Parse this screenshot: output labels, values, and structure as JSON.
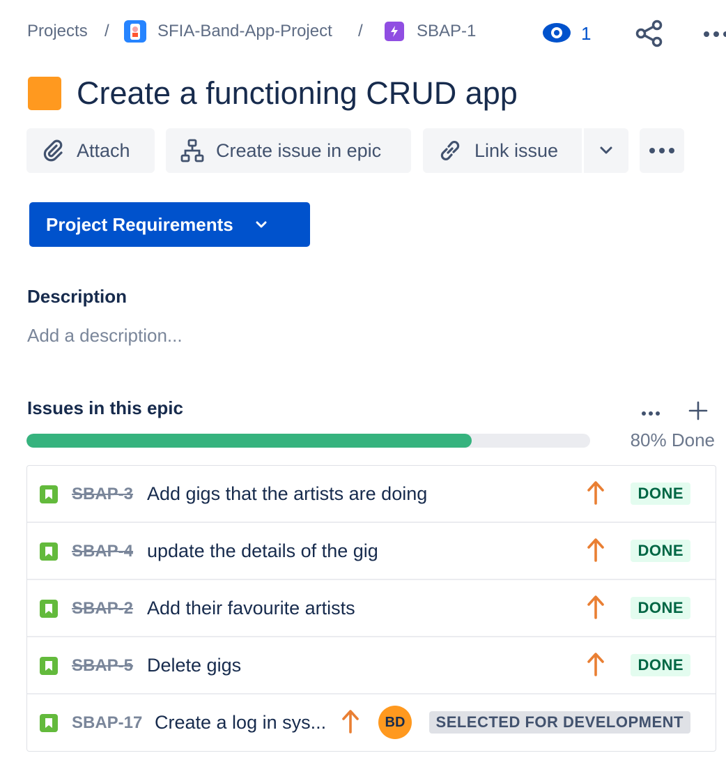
{
  "breadcrumb": {
    "projects": "Projects",
    "separator": "/",
    "project_name": "SFIA-Band-App-Project",
    "issue_key": "SBAP-1"
  },
  "header": {
    "watch_count": "1"
  },
  "issue": {
    "title": "Create a functioning CRUD app",
    "epic_color": "#ff991f"
  },
  "actions": {
    "attach": "Attach",
    "create_issue_in_epic": "Create issue in epic",
    "link_issue": "Link issue"
  },
  "status": {
    "label": "Project Requirements"
  },
  "description": {
    "heading": "Description",
    "placeholder": "Add a description..."
  },
  "epic_issues": {
    "heading": "Issues in this epic",
    "progress_label": "80% Done",
    "progress_fraction": 0.79,
    "items": [
      {
        "key": "SBAP-3",
        "summary": "Add gigs that the artists are doing",
        "status": "DONE",
        "done": true
      },
      {
        "key": "SBAP-4",
        "summary": "update the details of the gig",
        "status": "DONE",
        "done": true
      },
      {
        "key": "SBAP-2",
        "summary": "Add their favourite artists",
        "status": "DONE",
        "done": true
      },
      {
        "key": "SBAP-5",
        "summary": "Delete gigs",
        "status": "DONE",
        "done": true
      },
      {
        "key": "SBAP-17",
        "summary": "Create a log in sys...",
        "assignee": "BD",
        "status": "SELECTED FOR DEVELOPMENT",
        "done": false
      }
    ]
  },
  "colors": {
    "primary": "#0052cc",
    "done_green": "#36b37e",
    "priority_high": "#e97f33",
    "story_green": "#63ba3c"
  }
}
